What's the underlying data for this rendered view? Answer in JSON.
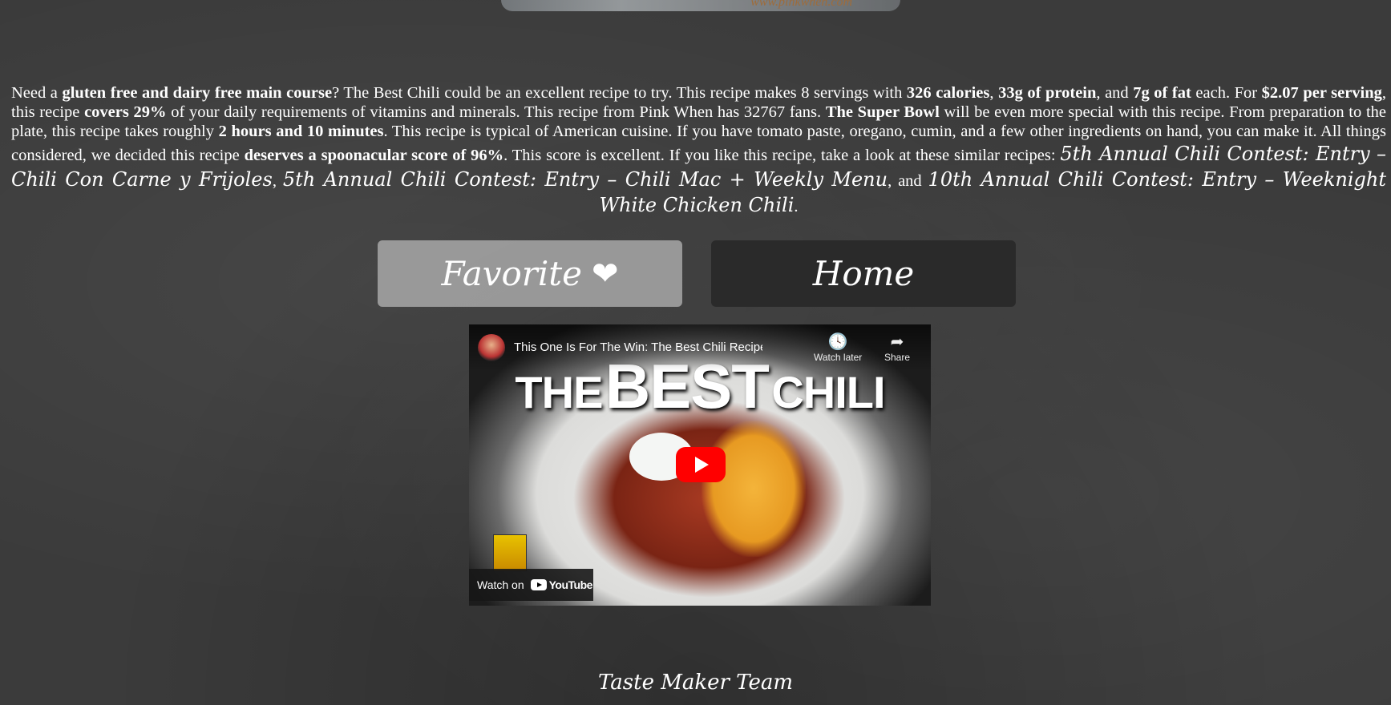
{
  "top_image": {
    "watermark": "www.pinkwhen.com"
  },
  "summary": {
    "t1": "Need a ",
    "b1": "gluten free and dairy free main course",
    "t2": "? The Best Chili could be an excellent recipe to try. This recipe makes 8 servings with ",
    "b2": "326 calories",
    "t3": ", ",
    "b3": "33g of protein",
    "t4": ", and ",
    "b4": "7g of fat",
    "t5": " each. For ",
    "b5": "$2.07 per serving",
    "t6": ", this recipe ",
    "b6": "covers 29%",
    "t7": " of your daily requirements of vitamins and minerals. This recipe from Pink When has 32767 fans. ",
    "b7": "The Super Bowl",
    "t8": " will be even more special with this recipe. From preparation to the plate, this recipe takes roughly ",
    "b8": "2 hours and 10 minutes",
    "t9": ". This recipe is typical of American cuisine. If you have tomato paste, oregano, cumin, and a few other ingredients on hand, you can make it. All things considered, we decided this recipe ",
    "b9": "deserves a spoonacular score of 96%",
    "t10": ". This score is excellent. If you like this recipe, take a look at these similar recipes: ",
    "link1": "5th Annual Chili Contest: Entry – Chili Con Carne y Frijoles",
    "t11": ", ",
    "link2": "5th Annual Chili Contest: Entry – Chili Mac + Weekly Menu",
    "t12": ", and ",
    "link3": "10th Annual Chili Contest: Entry – Weeknight White Chicken Chili",
    "t13": "."
  },
  "buttons": {
    "favorite_label": "Favorite",
    "favorite_icon": "❤",
    "home_label": "Home"
  },
  "video": {
    "title": "This One Is For The Win: The Best Chili Recipe Yo...",
    "thumb_line1": "THE",
    "thumb_line2": "BEST",
    "thumb_line3": "CHILI",
    "watch_later": "Watch later",
    "share": "Share",
    "watch_on": "Watch on",
    "youtube": "YouTube"
  },
  "footer": {
    "text": "Taste Maker Team"
  }
}
